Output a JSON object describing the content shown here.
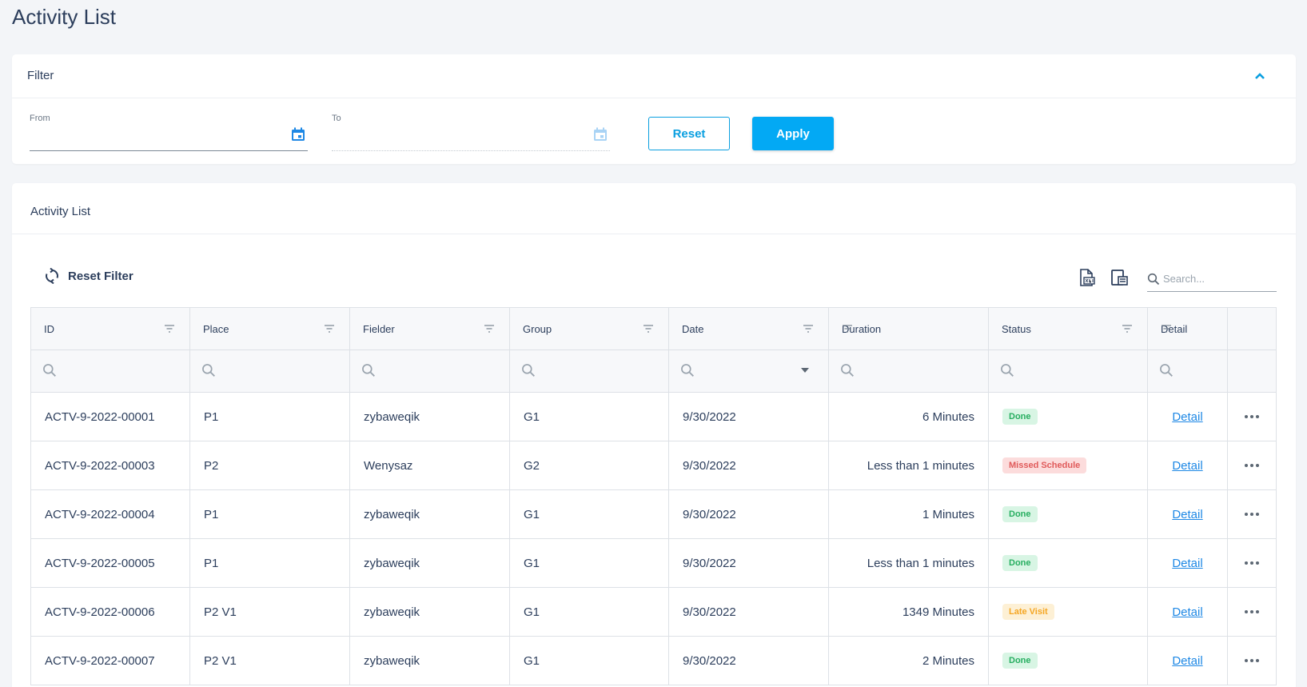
{
  "page": {
    "title": "Activity List"
  },
  "filter": {
    "title": "Filter",
    "from_label": "From",
    "to_label": "To",
    "reset_label": "Reset",
    "apply_label": "Apply"
  },
  "list": {
    "title": "Activity List",
    "reset_filter_label": "Reset Filter",
    "search_placeholder": "Search...",
    "columns": [
      "ID",
      "Place",
      "Fielder",
      "Group",
      "Date",
      "Duration",
      "Status",
      "Detail"
    ],
    "rows": [
      {
        "id": "ACTV-9-2022-00001",
        "place": "P1",
        "fielder": "zybaweqik",
        "group": "G1",
        "date": "9/30/2022",
        "duration": "6 Minutes",
        "status": "Done",
        "status_type": "done",
        "detail": "Detail"
      },
      {
        "id": "ACTV-9-2022-00003",
        "place": "P2",
        "fielder": "Wenysaz",
        "group": "G2",
        "date": "9/30/2022",
        "duration": "Less than 1 minutes",
        "status": "Missed Schedule",
        "status_type": "missed",
        "detail": "Detail"
      },
      {
        "id": "ACTV-9-2022-00004",
        "place": "P1",
        "fielder": "zybaweqik",
        "group": "G1",
        "date": "9/30/2022",
        "duration": "1 Minutes",
        "status": "Done",
        "status_type": "done",
        "detail": "Detail"
      },
      {
        "id": "ACTV-9-2022-00005",
        "place": "P1",
        "fielder": "zybaweqik",
        "group": "G1",
        "date": "9/30/2022",
        "duration": "Less than 1 minutes",
        "status": "Done",
        "status_type": "done",
        "detail": "Detail"
      },
      {
        "id": "ACTV-9-2022-00006",
        "place": "P2 V1",
        "fielder": "zybaweqik",
        "group": "G1",
        "date": "9/30/2022",
        "duration": "1349 Minutes",
        "status": "Late Visit",
        "status_type": "late",
        "detail": "Detail"
      },
      {
        "id": "ACTV-9-2022-00007",
        "place": "P2 V1",
        "fielder": "zybaweqik",
        "group": "G1",
        "date": "9/30/2022",
        "duration": "2 Minutes",
        "status": "Done",
        "status_type": "done",
        "detail": "Detail"
      }
    ]
  },
  "colors": {
    "accent": "#03a9f4",
    "done": "#27ae60",
    "missed": "#e05a5a",
    "late": "#f5a623"
  },
  "icons": [
    "chevron-up-icon",
    "calendar-icon",
    "refresh-icon",
    "export-excel-icon",
    "export-pdf-icon",
    "search-icon",
    "filter-icon",
    "dropdown-icon",
    "more-icon"
  ]
}
